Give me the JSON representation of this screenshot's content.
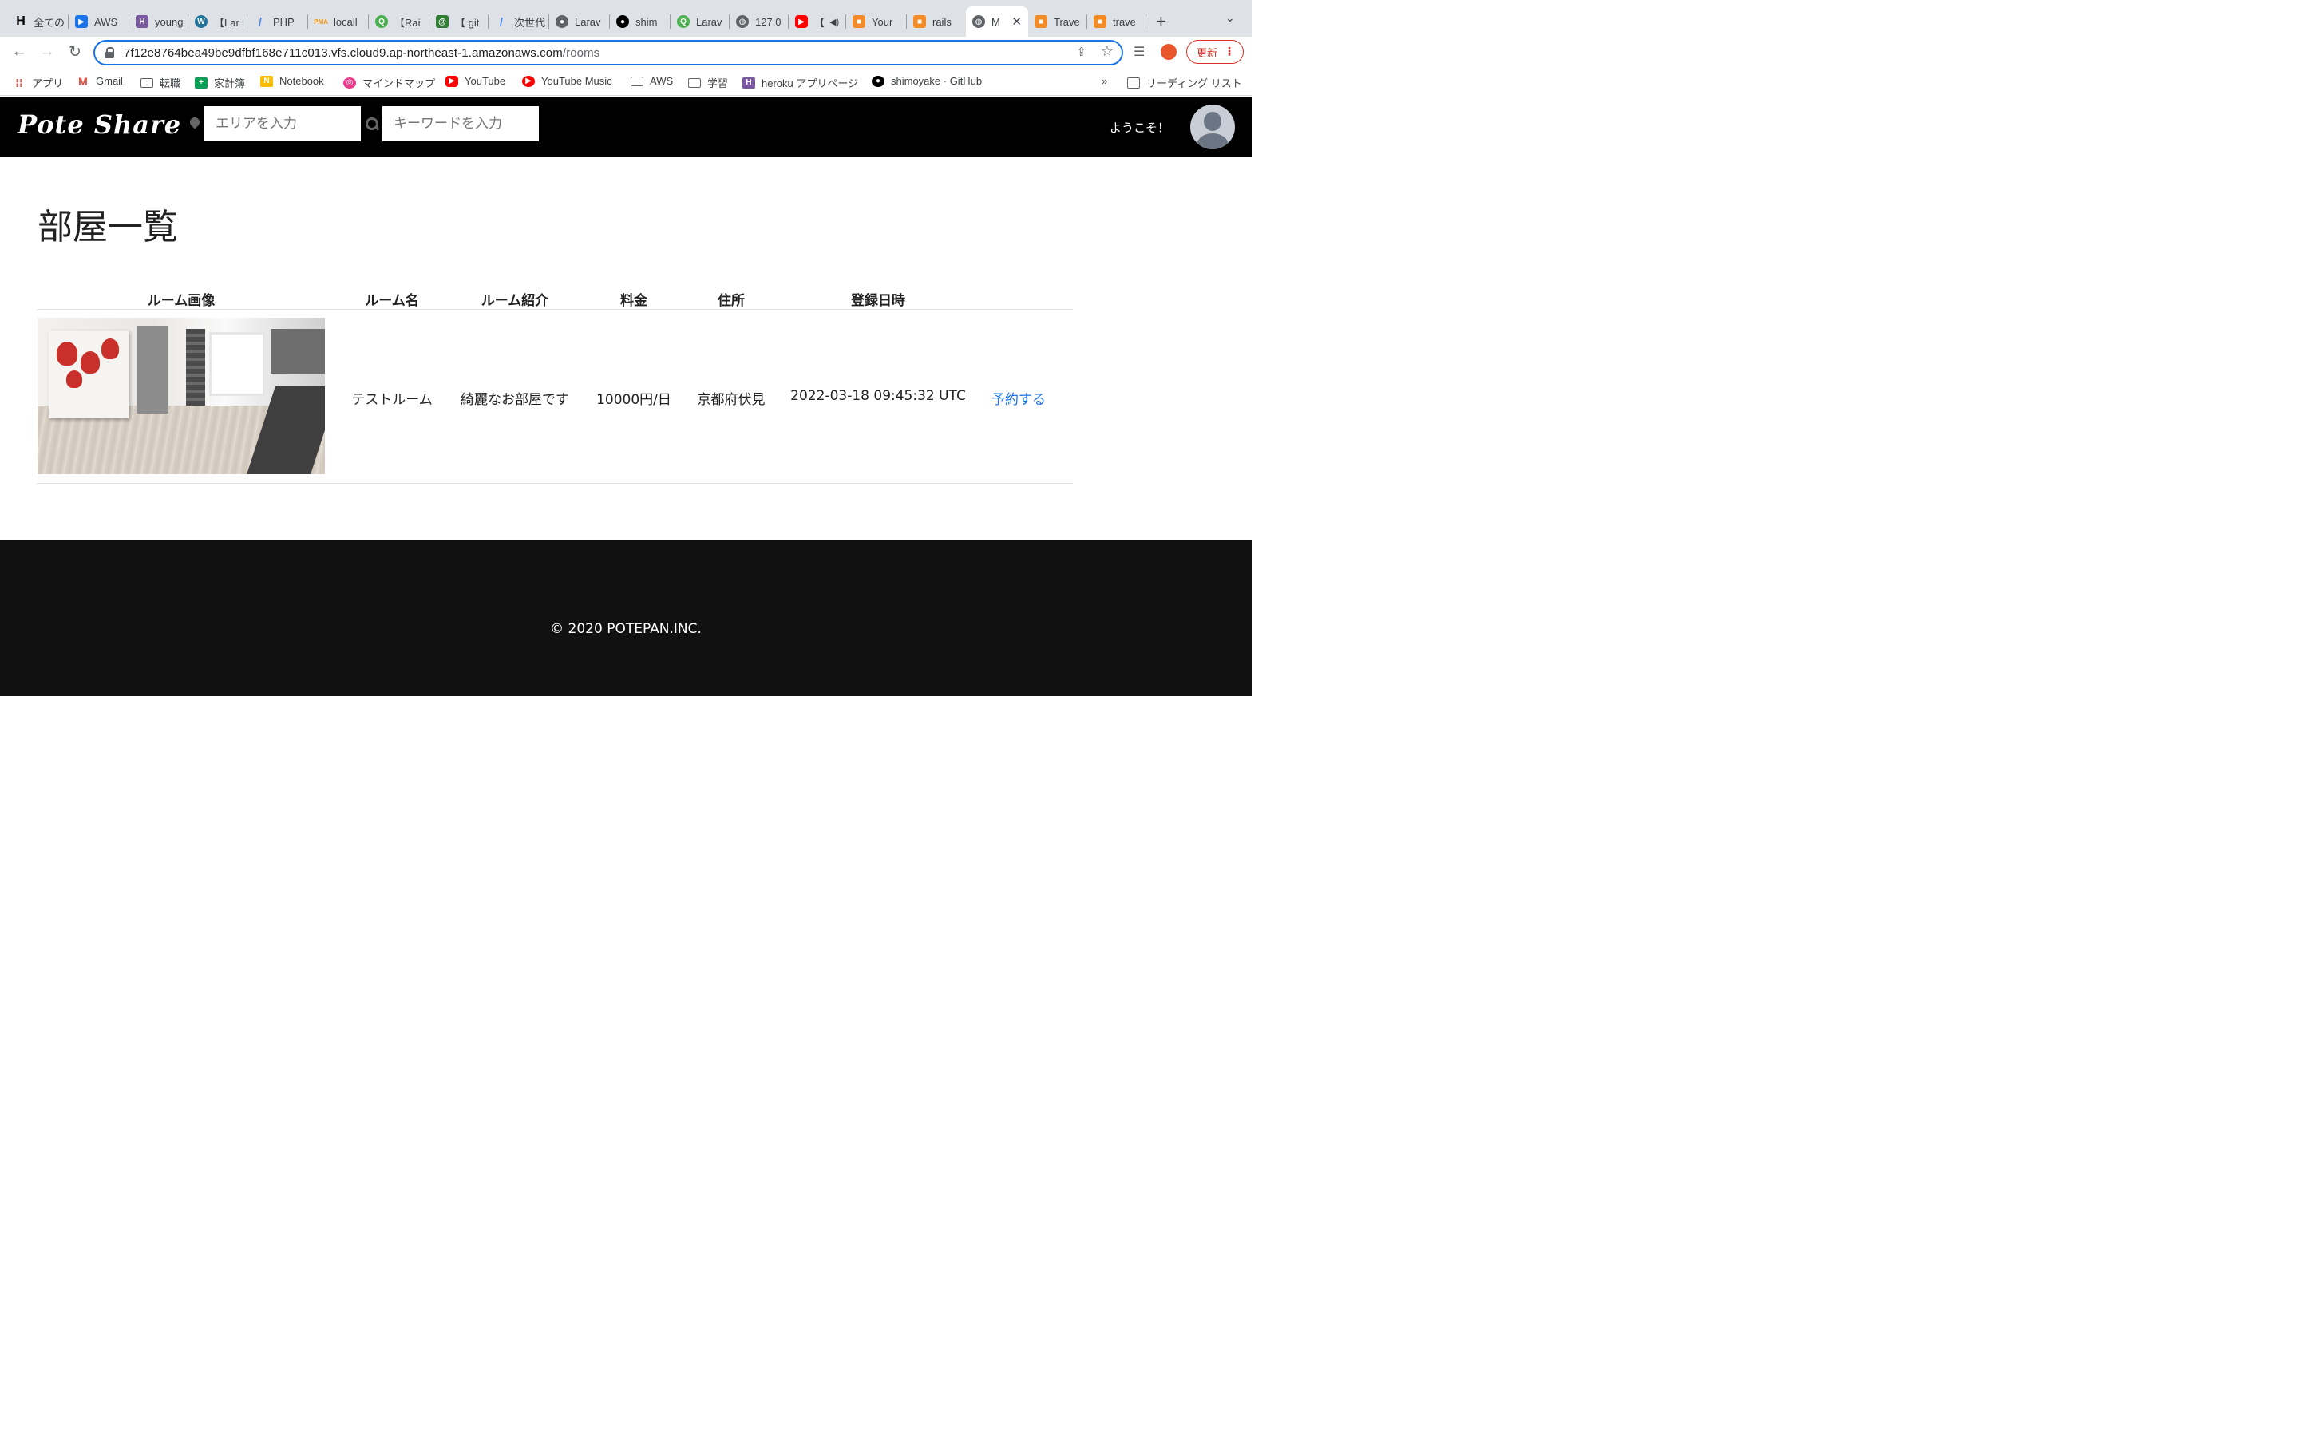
{
  "browser": {
    "tabs": [
      {
        "label": "全ての",
        "icon": "h-icon",
        "color": "#000000"
      },
      {
        "label": "AWS",
        "icon": "aws-icon",
        "color": "#1a73e8"
      },
      {
        "label": "young",
        "icon": "heroku-icon",
        "color": "#79589f"
      },
      {
        "label": "【Lar",
        "icon": "wordpress-icon",
        "color": "#21759b"
      },
      {
        "label": "PHP",
        "icon": "slash-icon",
        "color": "#4285f4"
      },
      {
        "label": "locall",
        "icon": "pma-icon",
        "color": "#f29111"
      },
      {
        "label": "【Rai",
        "icon": "green-circle-icon",
        "color": "#4caf50"
      },
      {
        "label": "【 git",
        "icon": "at-icon",
        "color": "#2e7d32"
      },
      {
        "label": "次世代",
        "icon": "slash-icon",
        "color": "#4285f4"
      },
      {
        "label": "Larav",
        "icon": "github-icon",
        "color": "#5f6368"
      },
      {
        "label": "shim",
        "icon": "github-icon",
        "color": "#000000"
      },
      {
        "label": "Larav",
        "icon": "green-circle-icon",
        "color": "#4caf50"
      },
      {
        "label": "127.0",
        "icon": "globe-icon",
        "color": "#5f6368"
      },
      {
        "label": "【",
        "icon": "youtube-icon",
        "color": "#ff0000"
      },
      {
        "label": "Your",
        "icon": "cube-icon",
        "color": "#f28c28"
      },
      {
        "label": "rails",
        "icon": "cube-icon",
        "color": "#f28c28"
      },
      {
        "label": "M",
        "icon": "globe-icon",
        "color": "#5f6368"
      },
      {
        "label": "Trave",
        "icon": "cube-icon",
        "color": "#f28c28"
      },
      {
        "label": "trave",
        "icon": "cube-icon",
        "color": "#f28c28"
      }
    ],
    "url_host": "7f12e8764bea49be9dfbf168e711c013.vfs.cloud9.ap-northeast-1.amazonaws.com",
    "url_path": "/rooms",
    "update_label": "更新",
    "bookmarks": [
      {
        "label": "アプリ",
        "icon": "apps-icon"
      },
      {
        "label": "Gmail",
        "icon": "gmail-icon"
      },
      {
        "label": "転職",
        "icon": "folder-icon"
      },
      {
        "label": "家計簿",
        "icon": "sheets-icon"
      },
      {
        "label": "Notebook",
        "icon": "notebook-icon"
      },
      {
        "label": "マインドマップ",
        "icon": "mindmap-icon"
      },
      {
        "label": "YouTube",
        "icon": "youtube-icon"
      },
      {
        "label": "YouTube Music",
        "icon": "youtube-music-icon"
      },
      {
        "label": "AWS",
        "icon": "folder-icon"
      },
      {
        "label": "学習",
        "icon": "folder-icon"
      },
      {
        "label": "heroku アプリページ",
        "icon": "heroku-icon"
      },
      {
        "label": "shimoyake · GitHub",
        "icon": "github-icon"
      }
    ],
    "more_bookmarks": "»",
    "reading_list": "リーディング リスト"
  },
  "site": {
    "logo": "Pote Share",
    "area_placeholder": "エリアを入力",
    "keyword_placeholder": "キーワードを入力",
    "welcome": "ようこそ！"
  },
  "main": {
    "title": "部屋一覧",
    "columns": [
      "ルーム画像",
      "ルーム名",
      "ルーム紹介",
      "料金",
      "住所",
      "登録日時"
    ],
    "rooms": [
      {
        "name": "テストルーム",
        "intro": "綺麗なお部屋です",
        "price": "10000円/日",
        "address": "京都府伏見",
        "created_at": "2022-03-18 09:45:32 UTC",
        "action": "予約する"
      }
    ]
  },
  "footer": {
    "copyright": "© 2020 POTEPAN.INC."
  }
}
